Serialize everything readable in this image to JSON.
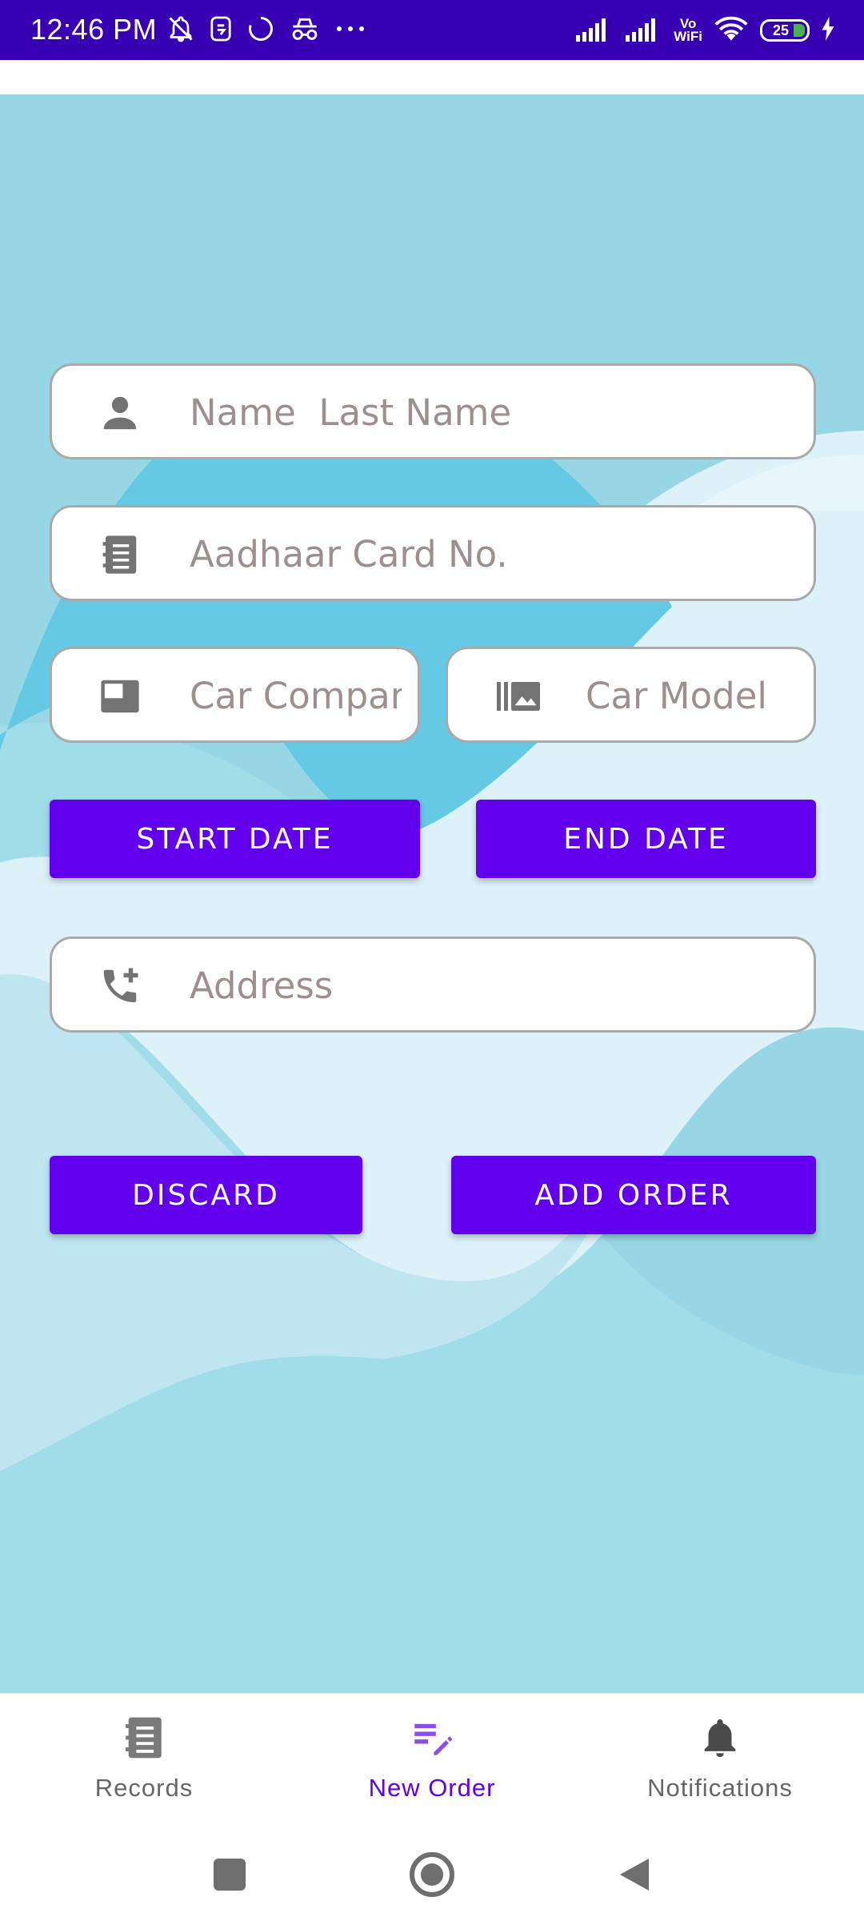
{
  "status_bar": {
    "time": "12:46 PM",
    "vowifi_top": "Vo",
    "vowifi_bottom": "WiFi",
    "battery_level": "25",
    "icons": [
      "muted-bell-icon",
      "sim-icon",
      "sync-icon",
      "incognito-icon",
      "more-dots-icon",
      "signal-icon",
      "signal-icon",
      "wifi-icon",
      "battery-icon",
      "charging-bolt-icon"
    ]
  },
  "form": {
    "name_placeholder": "Name  Last Name",
    "aadhaar_placeholder": "Aadhaar Card No.",
    "car_company_placeholder": "Car Company",
    "car_model_placeholder": "Car Model",
    "start_date_label": "START DATE",
    "end_date_label": "END DATE",
    "address_placeholder": "Address",
    "discard_label": "DISCARD",
    "add_order_label": "ADD ORDER",
    "icons": {
      "name": "person-icon",
      "aadhaar": "notebook-icon",
      "car_company": "featured-video-icon",
      "car_model": "burst-photo-icon",
      "address": "add-call-icon"
    }
  },
  "bottom_nav": {
    "items": [
      {
        "label": "Records",
        "icon": "records-notebook-icon",
        "active": false
      },
      {
        "label": "New Order",
        "icon": "edit-list-icon",
        "active": true
      },
      {
        "label": "Notifications",
        "icon": "bell-icon",
        "active": false
      }
    ]
  },
  "colors": {
    "status_bar": "#3700b3",
    "primary": "#6200ee",
    "background": "#97d7e5"
  }
}
